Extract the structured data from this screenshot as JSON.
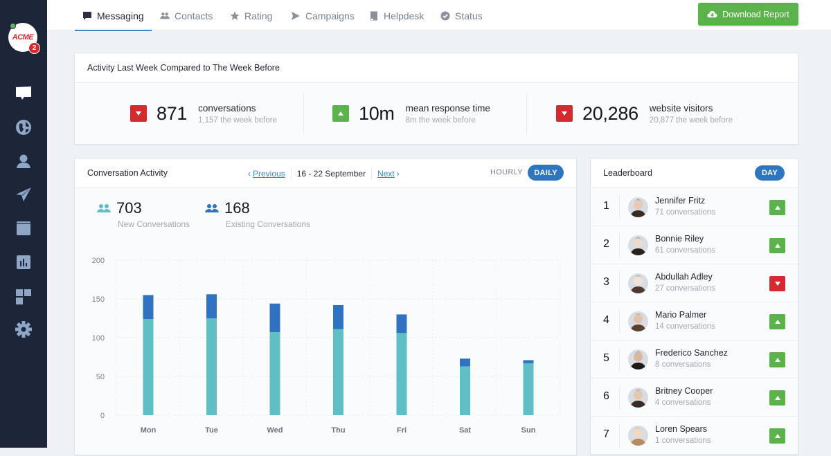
{
  "logo": {
    "text": "ACME",
    "badge_count": "2"
  },
  "sidebar": {
    "items": [
      {
        "name": "messaging",
        "icon": "chat-bubble-icon",
        "active": true
      },
      {
        "name": "globe",
        "icon": "globe-icon"
      },
      {
        "name": "contacts",
        "icon": "user-icon"
      },
      {
        "name": "campaigns",
        "icon": "paper-plane-icon"
      },
      {
        "name": "helpdesk",
        "icon": "book-icon"
      },
      {
        "name": "reports",
        "icon": "bar-chart-icon"
      },
      {
        "name": "apps",
        "icon": "grid-icon"
      },
      {
        "name": "settings",
        "icon": "gear-icon"
      }
    ]
  },
  "tabs": [
    {
      "label": "Messaging",
      "icon": "chat-icon",
      "active": true
    },
    {
      "label": "Contacts",
      "icon": "people-icon"
    },
    {
      "label": "Rating",
      "icon": "star-icon"
    },
    {
      "label": "Campaigns",
      "icon": "send-icon"
    },
    {
      "label": "Helpdesk",
      "icon": "book-icon"
    },
    {
      "label": "Status",
      "icon": "check-circle-icon"
    }
  ],
  "toolbar": {
    "download_label": "Download Report",
    "download_icon": "cloud-download-icon"
  },
  "colors": {
    "accent": "#2f76c0",
    "up": "#5cb24a",
    "down": "#d42b30",
    "new_series": "#5fbfc4",
    "existing_series": "#2f73c0",
    "sidebar_bg": "#1d2638"
  },
  "kpis": {
    "title": "Activity Last Week Compared to The Week Before",
    "items": [
      {
        "trend": "down",
        "value": "871",
        "label": "conversations",
        "sub": "1,157 the week before"
      },
      {
        "trend": "up",
        "value": "10m",
        "label": "mean response time",
        "sub": "8m the week before"
      },
      {
        "trend": "down",
        "value": "20,286",
        "label": "website visitors",
        "sub": "20,877 the week before"
      }
    ]
  },
  "activity": {
    "title": "Conversation Activity",
    "previous_label": "Previous",
    "range_label": "16 - 22 September",
    "next_label": "Next",
    "hourly_label": "HOURLY",
    "daily_label": "DAILY",
    "new_count": "703",
    "new_label": "New Conversations",
    "existing_count": "168",
    "existing_label": "Existing Conversations"
  },
  "chart_data": {
    "type": "bar",
    "stacked": true,
    "title": "Conversation Activity",
    "xlabel": "",
    "ylabel": "",
    "categories": [
      "Mon",
      "Tue",
      "Wed",
      "Thu",
      "Fri",
      "Sat",
      "Sun"
    ],
    "series": [
      {
        "name": "New Conversations",
        "color": "#5fbfc4",
        "values": [
          124,
          125,
          107,
          111,
          106,
          63,
          67
        ]
      },
      {
        "name": "Existing Conversations",
        "color": "#2f73c0",
        "values": [
          31,
          31,
          37,
          31,
          24,
          10,
          4
        ]
      }
    ],
    "ylim": [
      0,
      200
    ],
    "yticks": [
      0,
      50,
      100,
      150,
      200
    ],
    "grid": true,
    "legend": "none"
  },
  "leaderboard": {
    "title": "Leaderboard",
    "period_label": "DAY",
    "rows": [
      {
        "rank": "1",
        "name": "Jennifer Fritz",
        "sub": "71 conversations",
        "trend": "up"
      },
      {
        "rank": "2",
        "name": "Bonnie Riley",
        "sub": "61 conversations",
        "trend": "up"
      },
      {
        "rank": "3",
        "name": "Abdullah Adley",
        "sub": "27 conversations",
        "trend": "down"
      },
      {
        "rank": "4",
        "name": "Mario Palmer",
        "sub": "14 conversations",
        "trend": "up"
      },
      {
        "rank": "5",
        "name": "Frederico Sanchez",
        "sub": "8 conversations",
        "trend": "up"
      },
      {
        "rank": "6",
        "name": "Britney Cooper",
        "sub": "4 conversations",
        "trend": "up"
      },
      {
        "rank": "7",
        "name": "Loren Spears",
        "sub": "1 conversations",
        "trend": "up"
      }
    ]
  }
}
